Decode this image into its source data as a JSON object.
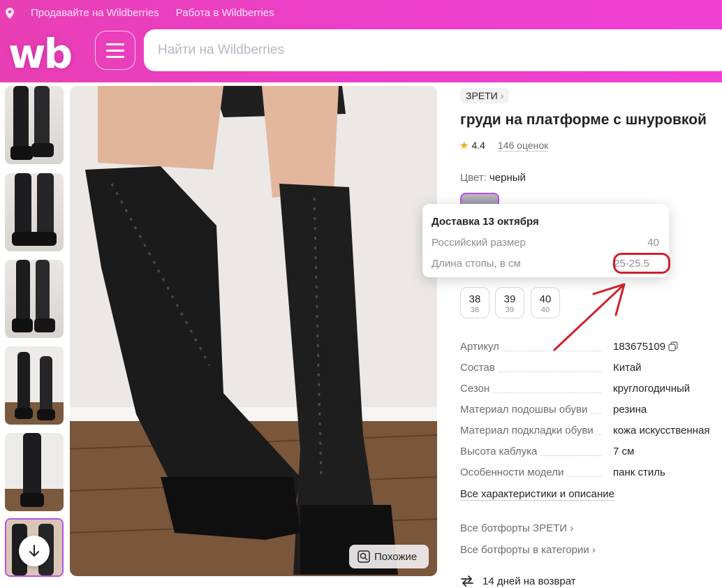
{
  "header": {
    "seller_link": "Продавайте на Wildberries",
    "job_link": "Работа в Wildberries",
    "logo_text": "wb",
    "search_placeholder": "Найти на Wildberries",
    "brand_color": "#ec3fca"
  },
  "gallery": {
    "thumbnail_count": 6,
    "active_index": 5
  },
  "main_image": {
    "similar_button": "Похожие"
  },
  "product": {
    "brand": "ЗРЕТИ",
    "title": "груди на платформе с шнуровкой",
    "rating": "4.4",
    "reviews": "146 оценок",
    "color_label": "Цвет:",
    "color_value": "черный"
  },
  "tooltip": {
    "title": "Доставка 13 октября",
    "rows": [
      {
        "label": "Российский размер",
        "value": "40"
      },
      {
        "label": "Длина стопы, в см",
        "value": "25-25.5"
      }
    ],
    "highlight_color": "#d11f2a"
  },
  "sizes": [
    {
      "main": "38",
      "sub": "38"
    },
    {
      "main": "39",
      "sub": "39"
    },
    {
      "main": "40",
      "sub": "40"
    }
  ],
  "params": [
    {
      "key": "Артикул",
      "value": "183675109"
    },
    {
      "key": "Состав",
      "value": "Китай"
    },
    {
      "key": "Сезон",
      "value": "круглогодичный"
    },
    {
      "key": "Материал подошвы обуви",
      "value": "резина"
    },
    {
      "key": "Материал подкладки обуви",
      "value": "кожа искусственная"
    },
    {
      "key": "Высота каблука",
      "value": "7 см"
    },
    {
      "key": "Особенности модели",
      "value": "панк стиль"
    }
  ],
  "links": {
    "all_characteristics": "Все характеристики и описание",
    "brand_boots": "Все ботфорты ЗРЕТИ",
    "category_boots": "Все ботфорты в категории",
    "return_policy": "14 дней на возврат"
  }
}
